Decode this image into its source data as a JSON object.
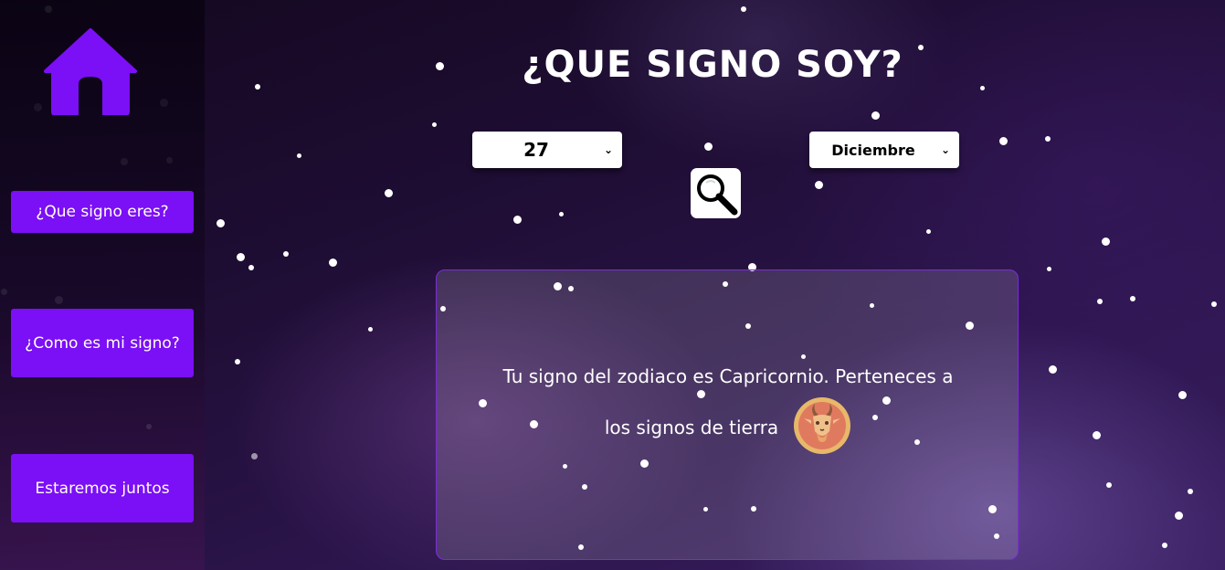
{
  "sidebar": {
    "home_icon": "home-icon",
    "items": [
      {
        "label": "¿Que signo eres?"
      },
      {
        "label": "¿Como es mi signo?"
      },
      {
        "label": "Estaremos juntos"
      }
    ]
  },
  "main": {
    "title": "¿QUE SIGNO SOY?",
    "day_select": {
      "value": "27"
    },
    "month_select": {
      "value": "Diciembre"
    },
    "search_icon": "magnifier-icon",
    "result": {
      "text": "Tu signo del zodiaco es Capricornio. Perteneces a los signos de tierra",
      "sign_icon": "capricorn-goat-icon"
    }
  },
  "colors": {
    "accent": "#7b0ff5",
    "result_border": "#7b2cd9",
    "sign_circle": "#e07a5f",
    "sign_ring": "#e8b86a"
  }
}
